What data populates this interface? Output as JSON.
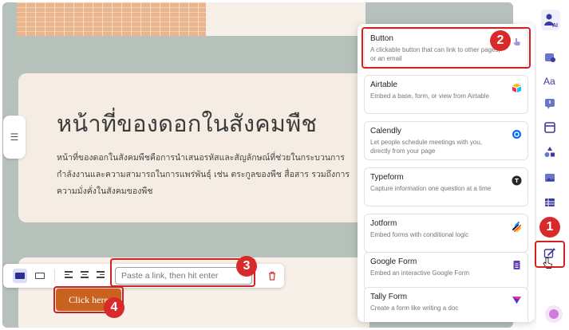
{
  "page": {
    "heading": "หน้าที่ของดอกในสังคมพืช",
    "body_lines": [
      "หน้าที่ของดอกในสังคมพืชคือการนำเสนอรหัสและสัญลักษณ์ที่ช่วยในกระบวนการ",
      "กำลังงานและความสามารถในการแพร่พันธุ์ เช่น ตระกูลของพืช สื่อสาร รวมถึงการ",
      "ความมั่งคั่งในสังคมของพืช"
    ],
    "cta_label": "Click here"
  },
  "toolbar": {
    "link_placeholder": "Paste a link, then hit enter"
  },
  "embed_menu": [
    {
      "name": "Button",
      "desc": "A clickable button that can link to other pages, or an email",
      "icon": "pointer-hand-icon"
    },
    {
      "name": "Airtable",
      "desc": "Embed a base, form, or view from Airtable",
      "icon": "airtable-icon"
    },
    {
      "name": "Calendly",
      "desc": "Let people schedule meetings with you, directly from your page",
      "icon": "calendly-icon"
    },
    {
      "name": "Typeform",
      "desc": "Capture information one question at a time",
      "icon": "typeform-icon"
    },
    {
      "name": "Jotform",
      "desc": "Embed forms with conditional logic",
      "icon": "jotform-icon"
    },
    {
      "name": "Google Form",
      "desc": "Embed an interactive Google Form",
      "icon": "google-form-icon"
    },
    {
      "name": "Tally Form",
      "desc": "Create a form like writing a doc",
      "icon": "tally-icon"
    }
  ],
  "annotations": [
    "1",
    "2",
    "3",
    "4"
  ],
  "rail_icons": [
    "ai-assistant-icon",
    "cards-icon",
    "text-style-icon",
    "callout-icon",
    "layout-icon",
    "shapes-icon",
    "image-icon",
    "table-icon",
    "embed-icon"
  ],
  "colors": {
    "accent": "#d61f1f",
    "cta": "#c9621f",
    "rail_accent": "#3a3aa0"
  }
}
